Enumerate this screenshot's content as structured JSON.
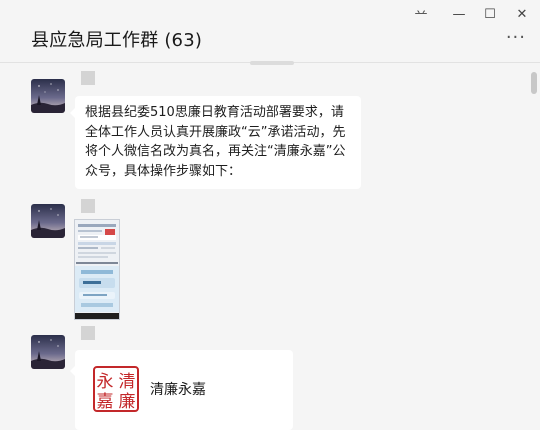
{
  "window": {
    "title": "县应急局工作群 (63)",
    "pin_glyph": "䒑",
    "minimize_glyph": "—",
    "maximize_glyph": "☐",
    "close_glyph": "✕",
    "more_glyph": "···"
  },
  "messages": [
    {
      "type": "text",
      "text": "根据县纪委510思廉日教育活动部署要求，请全体工作人员认真开展廉政“云”承诺活动，先将个人微信名改为真名，再关注“清廉永嘉”公众号，具体操作步骤如下："
    },
    {
      "type": "image"
    },
    {
      "type": "card",
      "title": "清廉永嘉",
      "seal_text": [
        "清",
        "廉",
        "永",
        "嘉"
      ]
    }
  ],
  "colors": {
    "background": "#f5f5f5",
    "bubble": "#ffffff",
    "seal_red": "#c3282a"
  }
}
